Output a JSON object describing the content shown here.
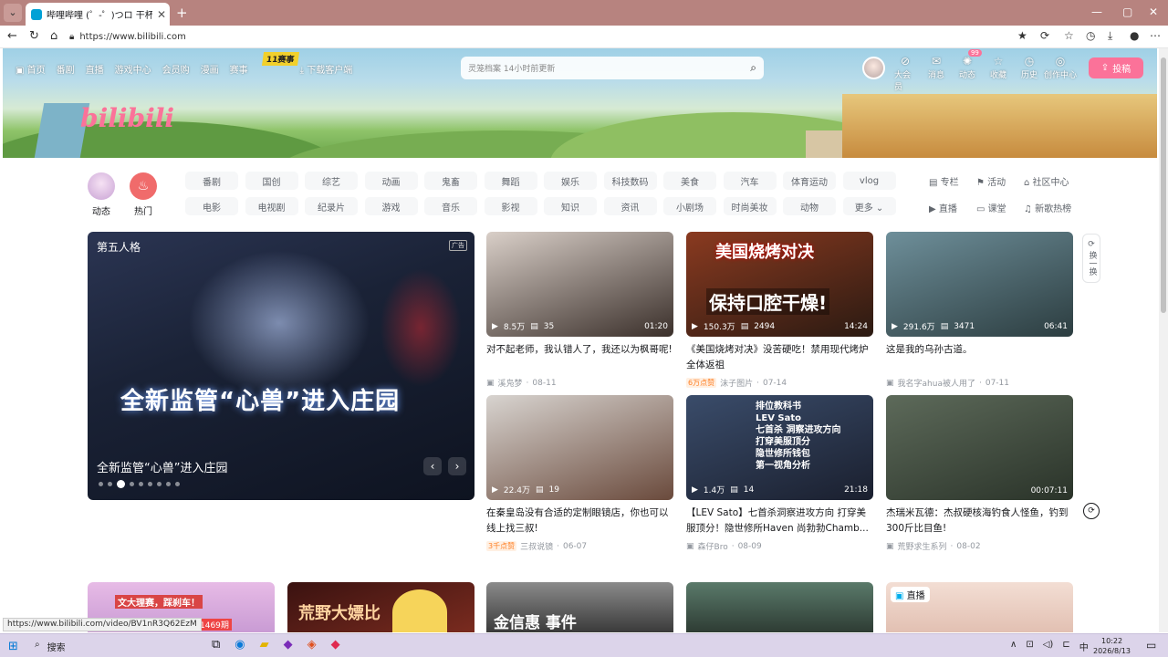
{
  "browser": {
    "tab_title": "哔哩哔哩 (゜-゜)つロ 干杯~-bilibili",
    "new_tab": "+",
    "url": "https://www.bilibili.com",
    "tab_menu": "⌄",
    "win_min": "—",
    "win_max": "▢",
    "win_close": "✕",
    "status_url": "https://www.bilibili.com/video/BV1nR3Q62EzM"
  },
  "header": {
    "nav": [
      "首页",
      "番剧",
      "直播",
      "游戏中心",
      "会员购",
      "漫画",
      "赛事"
    ],
    "event_badge": "11赛事",
    "download": "下载客户端",
    "logo": "bilibili",
    "search_placeholder": "灵笼档案 14小时前更新",
    "right_nav": [
      {
        "icon": "⊘",
        "label": "大会员",
        "name": "vip"
      },
      {
        "icon": "✉",
        "label": "消息",
        "name": "messages"
      },
      {
        "icon": "✺",
        "label": "动态",
        "name": "dynamic",
        "badge": "99"
      },
      {
        "icon": "☆",
        "label": "收藏",
        "name": "favorites"
      },
      {
        "icon": "◷",
        "label": "历史",
        "name": "history"
      },
      {
        "icon": "◎",
        "label": "创作中心",
        "name": "creator"
      }
    ],
    "upload_label": "投稿"
  },
  "channels": {
    "dynamic": "动态",
    "hot": "热门",
    "grid": [
      "番剧",
      "国创",
      "综艺",
      "动画",
      "鬼畜",
      "舞蹈",
      "娱乐",
      "科技数码",
      "美食",
      "汽车",
      "体育运动",
      "vlog",
      "电影",
      "电视剧",
      "纪录片",
      "游戏",
      "音乐",
      "影视",
      "知识",
      "资讯",
      "小剧场",
      "时尚美妆",
      "动物",
      "更多 ⌄"
    ],
    "right": [
      "专栏",
      "活动",
      "社区中心",
      "直播",
      "课堂",
      "新歌热榜"
    ]
  },
  "hero": {
    "logo_text": "第五人格",
    "ad": "广告",
    "overlay": "全新监管“心兽”进入庄园",
    "caption": "全新监管“心兽”进入庄园",
    "active_dot": 3,
    "dot_count": 9
  },
  "cards": [
    {
      "views": "8.5万",
      "danmaku": "35",
      "duration": "01:20",
      "title": "对不起老师，我认错人了，我还以为枫哥呢!",
      "tag": "",
      "up": "溪凫梦",
      "date": "08-11",
      "colors": [
        "#d9cfc8",
        "#3a2f2a"
      ]
    },
    {
      "views": "150.3万",
      "danmaku": "2494",
      "duration": "14:24",
      "title": "《美国烧烤对决》没苦硬吃！禁用现代烤炉 全体返祖",
      "tag": "6万点赞",
      "up": "沫子图片",
      "date": "07-14",
      "colors": [
        "#8a3a20",
        "#2b1a12"
      ]
    },
    {
      "views": "291.6万",
      "danmaku": "3471",
      "duration": "06:41",
      "title": "这是我的乌孙古道。",
      "tag": "",
      "up": "我名字ahua被人用了",
      "date": "07-11",
      "colors": [
        "#6e8f9a",
        "#2c3d40"
      ]
    },
    {
      "views": "22.4万",
      "danmaku": "19",
      "duration": "",
      "title": "在秦皇岛没有合适的定制眼镜店，你也可以线上找三叔!",
      "tag": "3千点赞",
      "up": "三叔说镜",
      "date": "06-07",
      "colors": [
        "#d8d4d0",
        "#6a4a3c"
      ]
    },
    {
      "views": "1.4万",
      "danmaku": "14",
      "duration": "21:18",
      "title": "【LEV Sato】七首杀洞察进攻方向 打穿美服顶分！隐世修所Haven 尚勃勃Chamb...",
      "tag": "",
      "up": "森仔Bro",
      "date": "08-09",
      "colors": [
        "#3a4c6a",
        "#1a1f2e"
      ]
    },
    {
      "views": "",
      "danmaku": "",
      "duration": "00:07:11",
      "title": "杰瑞米瓦德：杰叔硬核海钓食人怪鱼，钓到300斤比目鱼!",
      "tag": "",
      "up": "荒野求生系列",
      "date": "08-02",
      "colors": [
        "#5d6a5a",
        "#2a3329"
      ]
    }
  ],
  "card_overlays": {
    "c2_top": "美国烧烤对决",
    "c2_bottom": "保持口腔干燥!",
    "c5_l1": "排位教科书",
    "c5_l2": "LEV Sato",
    "c5_l3": "七首杀 洞察进攻方向",
    "c5_l4": "打穿美服顶分",
    "c5_l5": "隐世修所钱包",
    "c5_l6": "第一视角分析"
  },
  "refresh": {
    "icon": "⟳",
    "label": "换一换"
  },
  "bottom_row": {
    "b1_text": "文大理赛，踩刹车！",
    "b1_badge": "1469期",
    "b2_text": "荒野大嫖比",
    "b3_text": "金信惠 事件",
    "b5_badge": "直播"
  },
  "taskbar": {
    "start": "⊞",
    "search": "搜索",
    "tray": [
      "∧",
      "⊡",
      "◁)",
      "⊏",
      "中"
    ],
    "time": "10:22",
    "date": "2026/8/13",
    "notify": "▭"
  },
  "colors": {
    "accent": "#fb7299",
    "tabbar": "#b7837f",
    "taskbar": "#dcd4ea"
  }
}
